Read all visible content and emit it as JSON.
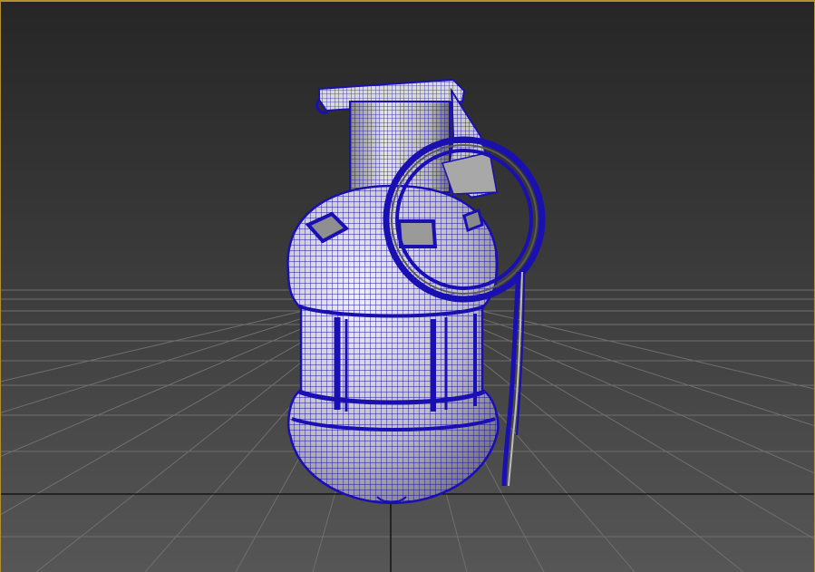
{
  "viewport": {
    "active_border_color": "#b09030",
    "grid_color": "#7a7a7a",
    "axis_color": "#000000",
    "wire_color": "#1a0fb0",
    "shade_light": "#e8e8e8",
    "shade_dark": "#6a6a6a"
  },
  "model": {
    "type": "hand-grenade",
    "display_mode": "wireframe-on-shaded"
  }
}
